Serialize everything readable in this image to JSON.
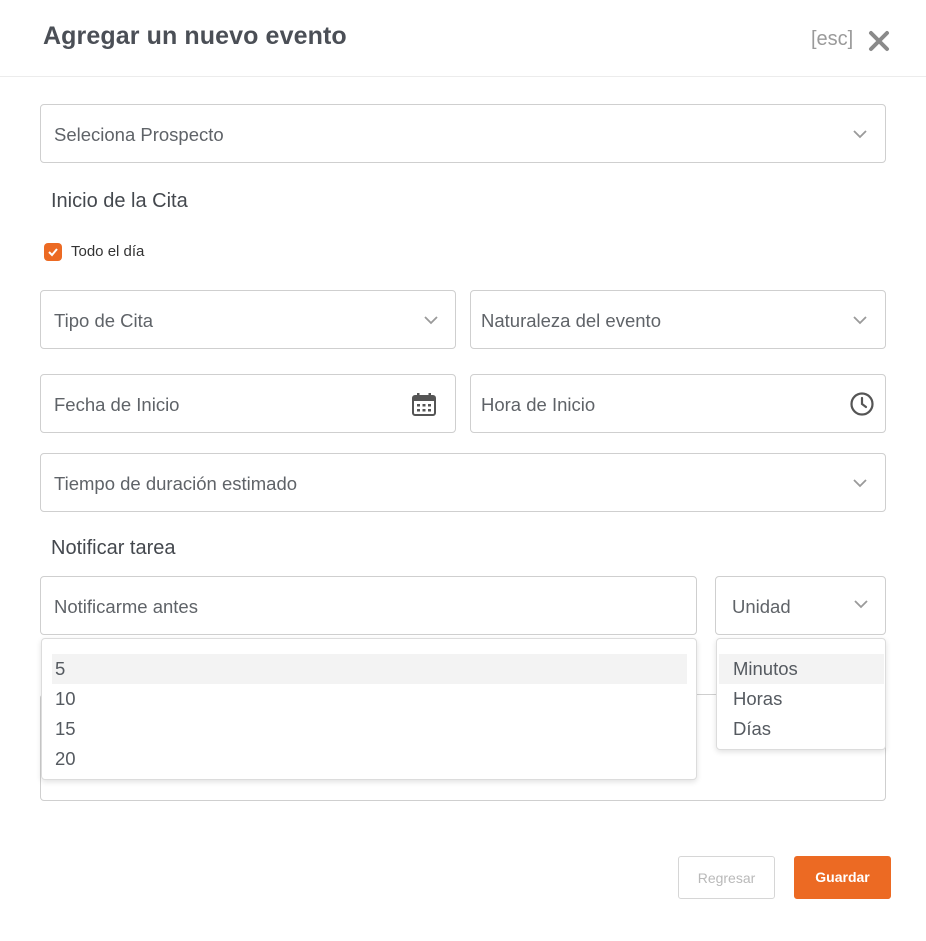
{
  "header": {
    "title": "Agregar un nuevo evento",
    "esc_hint": "[esc]",
    "close_icon": "close-icon"
  },
  "prospect_select": {
    "placeholder": "Seleciona Prospecto"
  },
  "start_section": {
    "title": "Inicio de la Cita",
    "all_day": {
      "label": "Todo el día",
      "checked": true,
      "color": "#ec6a23"
    }
  },
  "appointment_type": {
    "placeholder": "Tipo de Cita"
  },
  "event_nature": {
    "placeholder": "Naturaleza del evento"
  },
  "start_date": {
    "placeholder": "Fecha de Inicio",
    "icon": "calendar-icon"
  },
  "start_time": {
    "placeholder": "Hora de Inicio",
    "icon": "clock-icon"
  },
  "duration": {
    "placeholder": "Tiempo de duración estimado"
  },
  "notify_section": {
    "title": "Notificar tarea"
  },
  "notify_before": {
    "placeholder": "Notificarme antes",
    "options": [
      "5",
      "10",
      "15",
      "20"
    ],
    "highlighted": "5"
  },
  "unit": {
    "placeholder": "Unidad",
    "options": [
      "Minutos",
      "Horas",
      "Días"
    ],
    "highlighted": "Minutos"
  },
  "footer": {
    "back_label": "Regresar",
    "save_label": "Guardar",
    "accent_color": "#ec6a23"
  }
}
